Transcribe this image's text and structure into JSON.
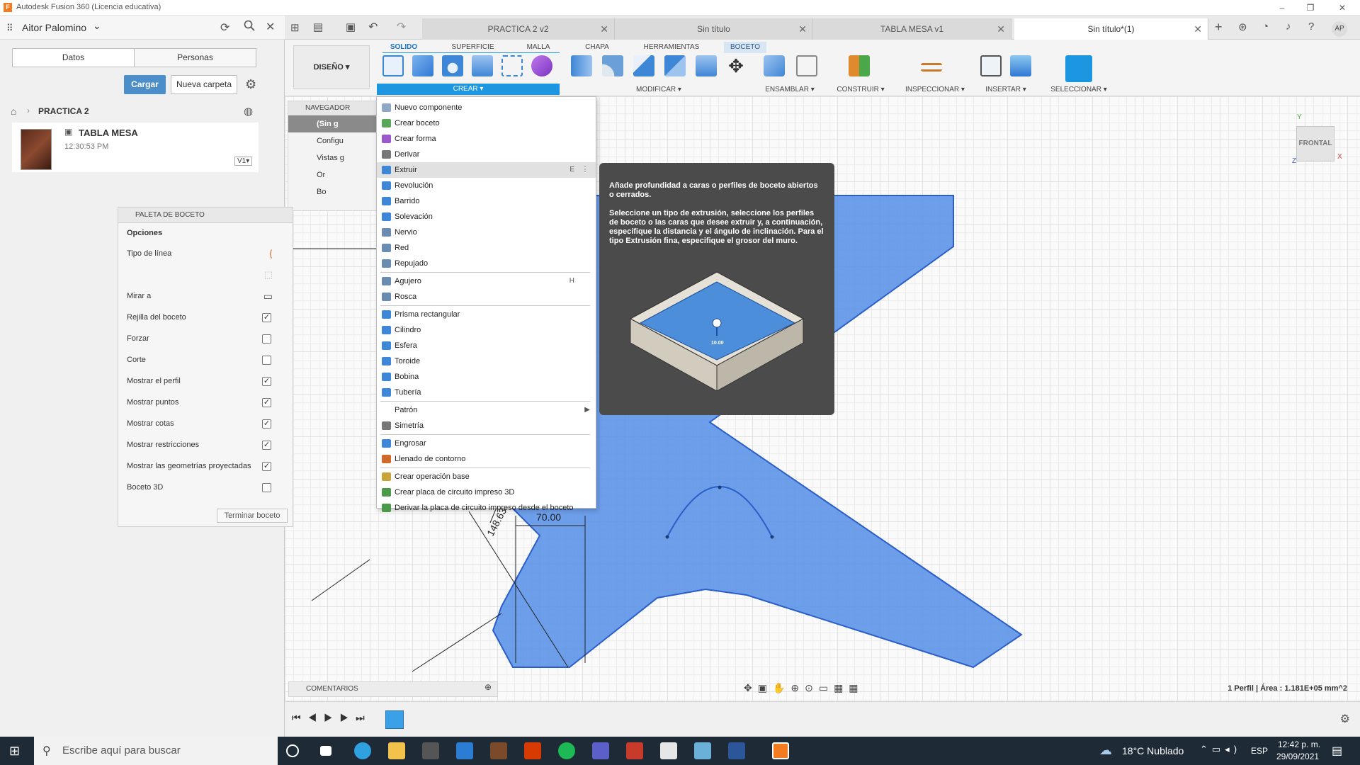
{
  "app": {
    "title": "Autodesk Fusion 360 (Licencia educativa)",
    "logo": "F",
    "minimize": "–",
    "restore": "❐",
    "close": "✕"
  },
  "left": {
    "user": "Aitor Palomino",
    "user_chevron": "⌄",
    "tabs": [
      "Datos",
      "Personas"
    ],
    "cargar": "Cargar",
    "nueva_carpeta": "Nueva carpeta",
    "breadcrumb": "PRACTICA 2",
    "file": {
      "name": "TABLA MESA",
      "time": "12:30:53 PM",
      "version": "V1▾"
    }
  },
  "doc_tabs": [
    {
      "label": "PRACTICA 2 v2"
    },
    {
      "label": "Sin título"
    },
    {
      "label": "TABLA MESA v1"
    },
    {
      "label": "Sin título*(1)"
    }
  ],
  "ribbon": {
    "workspace": "DISEÑO ▾",
    "tabs": [
      "SOLIDO",
      "SUPERFICIE",
      "MALLA",
      "CHAPA",
      "HERRAMIENTAS",
      "BOCETO"
    ],
    "groups": [
      "CREAR ▾",
      "MODIFICAR ▾",
      "ENSAMBLAR ▾",
      "CONSTRUIR ▾",
      "INSPECCIONAR ▾",
      "INSERTAR ▾",
      "SELECCIONAR ▾"
    ]
  },
  "navigator": {
    "title": "NAVEGADOR",
    "rows": [
      "(Sin g",
      "Configu",
      "Vistas g",
      "Or",
      "Bo"
    ]
  },
  "palette": {
    "title": "PALETA DE BOCETO",
    "section": "Opciones",
    "rows": [
      {
        "label": "Tipo de línea",
        "control": "icon"
      },
      {
        "label": "",
        "control": "icon2"
      },
      {
        "label": "Mirar a",
        "control": "icon3"
      },
      {
        "label": "Rejilla del boceto",
        "checked": true
      },
      {
        "label": "Forzar",
        "checked": false
      },
      {
        "label": "Corte",
        "checked": false
      },
      {
        "label": "Mostrar el perfil",
        "checked": true
      },
      {
        "label": "Mostrar puntos",
        "checked": true
      },
      {
        "label": "Mostrar cotas",
        "checked": true
      },
      {
        "label": "Mostrar restricciones",
        "checked": true
      },
      {
        "label": "Mostrar las geometrías proyectadas",
        "checked": true
      },
      {
        "label": "Boceto 3D",
        "checked": false
      }
    ],
    "finish": "Terminar boceto"
  },
  "menu": {
    "items": [
      {
        "label": "Nuevo componente",
        "icon": "component-icon",
        "color": "#8fa9c4"
      },
      {
        "label": "Crear boceto",
        "icon": "sketch-icon",
        "color": "#5aa65a"
      },
      {
        "label": "Crear forma",
        "icon": "form-icon",
        "color": "#9b59c9"
      },
      {
        "label": "Derivar",
        "icon": "derive-icon",
        "color": "#777777"
      },
      {
        "label": "Extruir",
        "icon": "extrude-icon",
        "color": "#3e86d6",
        "shortcut": "E",
        "highlight": true
      },
      {
        "label": "Revolución",
        "icon": "revolve-icon",
        "color": "#3e86d6"
      },
      {
        "label": "Barrido",
        "icon": "sweep-icon",
        "color": "#3e86d6"
      },
      {
        "label": "Solevación",
        "icon": "loft-icon",
        "color": "#3e86d6"
      },
      {
        "label": "Nervio",
        "icon": "rib-icon",
        "color": "#6a8cb0"
      },
      {
        "label": "Red",
        "icon": "web-icon",
        "color": "#6a8cb0"
      },
      {
        "label": "Repujado",
        "icon": "emboss-icon",
        "color": "#6a8cb0"
      },
      {
        "label": "Agujero",
        "icon": "hole-icon",
        "color": "#6a8cb0",
        "shortcut": "H",
        "sep": true
      },
      {
        "label": "Rosca",
        "icon": "thread-icon",
        "color": "#6a8cb0"
      },
      {
        "label": "Prisma rectangular",
        "icon": "box-icon",
        "color": "#3e86d6",
        "sep": true
      },
      {
        "label": "Cilindro",
        "icon": "cylinder-icon",
        "color": "#3e86d6"
      },
      {
        "label": "Esfera",
        "icon": "sphere-icon",
        "color": "#3e86d6"
      },
      {
        "label": "Toroide",
        "icon": "torus-icon",
        "color": "#3e86d6"
      },
      {
        "label": "Bobina",
        "icon": "coil-icon",
        "color": "#3e86d6"
      },
      {
        "label": "Tubería",
        "icon": "pipe-icon",
        "color": "#3e86d6"
      },
      {
        "label": "Patrón",
        "icon": "",
        "color": "",
        "submenu": "▶",
        "sep": true
      },
      {
        "label": "Simetría",
        "icon": "mirror-icon",
        "color": "#777777"
      },
      {
        "label": "Engrosar",
        "icon": "thicken-icon",
        "color": "#3e86d6",
        "sep": true
      },
      {
        "label": "Llenado de contorno",
        "icon": "boundary-fill-icon",
        "color": "#d06a2a"
      },
      {
        "label": "Crear operación base",
        "icon": "base-feature-icon",
        "color": "#c9a43a",
        "sep": true
      },
      {
        "label": "Crear placa de circuito impreso 3D",
        "icon": "pcb-icon",
        "color": "#4a9a4a"
      },
      {
        "label": "Derivar la placa de circuito impreso desde el boceto",
        "icon": "pcb-sketch-icon",
        "color": "#4a9a4a"
      }
    ]
  },
  "tooltip": {
    "p1": "Añade profundidad a caras o perfiles de boceto abiertos o cerrados.",
    "p2": "Seleccione un tipo de extrusión, seleccione los perfiles de boceto o las caras que desee extruir y, a continuación, especifique la distancia y el ángulo de inclinación. Para el tipo Extrusión fina, especifique el grosor del muro.",
    "value": "10.00"
  },
  "canvas": {
    "dim1": "70.00",
    "dim2": "148.63",
    "viewcube": "FRONTAL",
    "axis_y": "Y",
    "axis_x": "X",
    "axis_z": "Z"
  },
  "comments": "COMENTARIOS",
  "status": "1 Perfil | Área : 1.181E+05 mm^2",
  "taskbar": {
    "search": "Escribe aquí para buscar",
    "weather": "18°C Nublado",
    "lang": "ESP",
    "time": "12:42 p. m.",
    "date": "29/09/2021"
  },
  "colors": {
    "accent": "#1c96e0",
    "sketch_fill": "#5d94e8",
    "tooltip_bg": "#4b4b4b"
  }
}
